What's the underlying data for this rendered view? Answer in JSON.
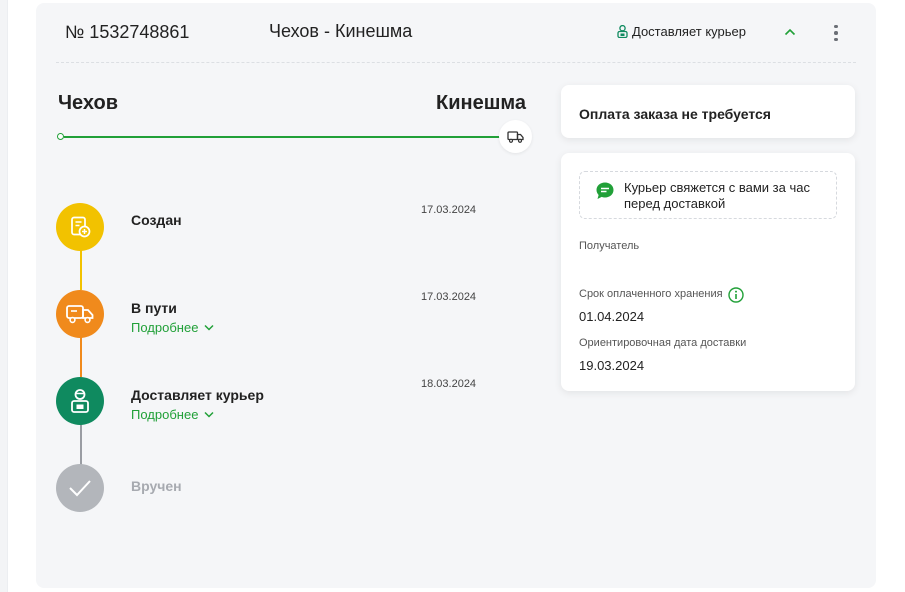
{
  "header": {
    "order_number": "№ 1532748861",
    "route": "Чехов - Кинешма",
    "status": "Доставляет курьер"
  },
  "route": {
    "from": "Чехов",
    "to": "Кинешма"
  },
  "timeline": [
    {
      "title": "Создан",
      "date": "17.03.2024",
      "color": "#f2c200"
    },
    {
      "title": "В пути",
      "date": "17.03.2024",
      "more": "Подробнее",
      "color": "#f08a1c"
    },
    {
      "title": "Доставляет курьер",
      "date": "18.03.2024",
      "more": "Подробнее",
      "color": "#0f8a5f"
    },
    {
      "title": "Вручен",
      "color": "#b3b6bb"
    }
  ],
  "payment": {
    "text": "Оплата заказа не требуется"
  },
  "info": {
    "notice": "Курьер свяжется с вами за час перед доставкой",
    "recipient_label": "Получатель",
    "storage_label": "Срок оплаченного хранения",
    "storage_value": "01.04.2024",
    "delivery_label": "Ориентировочная дата доставки",
    "delivery_value": "19.03.2024"
  },
  "colors": {
    "accent": "#21a038",
    "card_bg": "#f5f6f8"
  },
  "icons": {
    "status": "courier-icon",
    "collapse": "chevron-up-icon",
    "more": "kebab-menu-icon",
    "route_end": "truck-icon",
    "notice": "chat-icon",
    "info": "info-icon"
  }
}
